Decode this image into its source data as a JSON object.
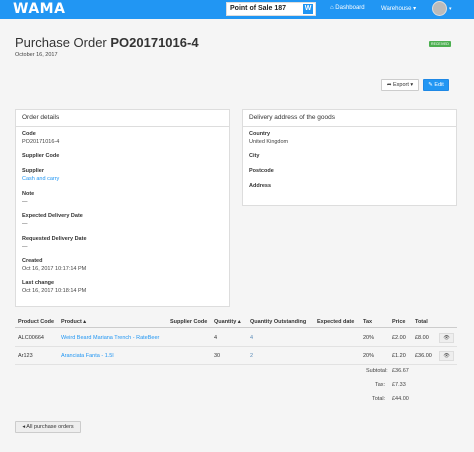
{
  "topbar": {
    "logo": "WAMA",
    "pos_label": "Point of Sale 187",
    "pos_icon": "W",
    "dashboard": "⌂ Dashboard",
    "warehouse": "Warehouse ▾",
    "avatar_caret": "▾"
  },
  "header": {
    "title_prefix": "Purchase Order ",
    "title_code": "PO20171016-4",
    "date": "October 16, 2017",
    "status_badge": "RECEIVED",
    "export_label": "➦ Export ▾",
    "edit_label": "✎ Edit"
  },
  "order_details": {
    "heading": "Order details",
    "fields": [
      {
        "label": "Code",
        "value": "PO20171016-4"
      },
      {
        "label": "Supplier Code",
        "value": ""
      },
      {
        "label": "Supplier",
        "value": "Cash and carry"
      },
      {
        "label": "Note",
        "value": "—"
      },
      {
        "label": "Expected Delivery Date",
        "value": "—"
      },
      {
        "label": "Requested Delivery Date",
        "value": "—"
      },
      {
        "label": "Created",
        "value": "Oct 16, 2017 10:17:14 PM"
      },
      {
        "label": "Last change",
        "value": "Oct 16, 2017 10:18:14 PM"
      }
    ]
  },
  "delivery": {
    "heading": "Delivery address of the goods",
    "fields": [
      {
        "label": "Country",
        "value": "United Kingdom"
      },
      {
        "label": "City",
        "value": ""
      },
      {
        "label": "Postcode",
        "value": ""
      },
      {
        "label": "Address",
        "value": ""
      }
    ]
  },
  "table": {
    "headers": [
      "Product Code",
      "Product ▴",
      "Supplier Code",
      "Quantity ▴",
      "Quantity Outstanding",
      "Expected date",
      "Tax",
      "Price",
      "Total"
    ],
    "rows": [
      {
        "code": "ALC00664",
        "product": "Weird Beard Mariana Trench - RateBeer",
        "supplier_code": "",
        "quantity": "4",
        "outstanding": "4",
        "expected": "",
        "tax": "20%",
        "price": "£2.00",
        "total": "£8.00"
      },
      {
        "code": "Ar123",
        "product": "Aranciata Fanta - 1.5l",
        "supplier_code": "",
        "quantity": "30",
        "outstanding": "2",
        "expected": "",
        "tax": "20%",
        "price": "£1.20",
        "total": "£36.00"
      }
    ],
    "eye_icon": "👁",
    "subtotal_label": "Subtotal:",
    "subtotal_value": "£36.67",
    "tax_label": "Tax:",
    "tax_value": "£7.33",
    "total_label": "Total:",
    "total_value": "£44.00"
  },
  "footer": {
    "back_label": "◂ All purchase orders"
  },
  "colors": {
    "primary": "#2196f3",
    "success": "#4caf50"
  }
}
